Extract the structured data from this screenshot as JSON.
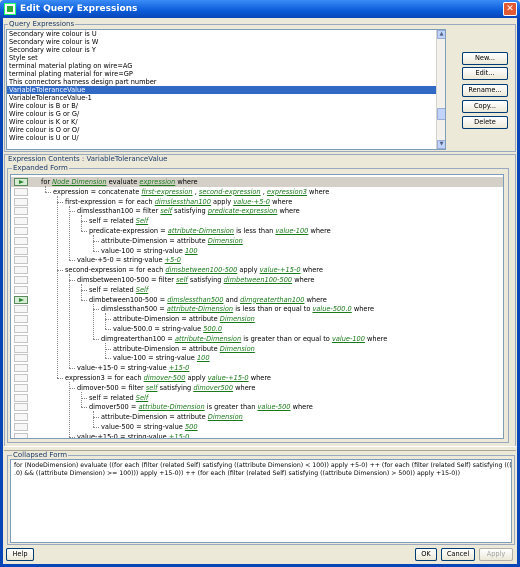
{
  "window": {
    "title": "Edit Query Expressions"
  },
  "query_expressions": {
    "label": "Query Expressions",
    "items": [
      "Secondary wire colour is U",
      "Secondary wire colour is W",
      "Secondary wire colour is Y",
      "Style set",
      "terminal material plating on wire=AG",
      "terminal plating material for wire=GP",
      "This connectors harness design  part number",
      "VariableToleranceValue",
      "VariableToleranceValue-1",
      "Wire colour is B or B/",
      "Wire colour is G or G/",
      "Wire colour is K or K/",
      "Wire colour is O or O/",
      "Wire colour is U or U/"
    ],
    "selected_index": 7
  },
  "buttons": {
    "new": "New...",
    "edit": "Edit...",
    "rename": "Rename...",
    "copy": "Copy...",
    "delete": "Delete",
    "help": "Help",
    "ok": "OK",
    "cancel": "Cancel",
    "apply": "Apply"
  },
  "expression_contents": {
    "label": "Expression Contents : VariableToleranceValue",
    "expanded_label": "Expanded Form",
    "collapsed_label": "Collapsed Form",
    "rows": [
      {
        "indent": 0,
        "marker": "on",
        "highlight": true,
        "parts": [
          [
            "t",
            "for "
          ],
          [
            "l",
            "Node Dimension"
          ],
          [
            "t",
            " evaluate "
          ],
          [
            "l",
            "expression"
          ],
          [
            "t",
            " where"
          ]
        ]
      },
      {
        "indent": 1,
        "parts": [
          [
            "t",
            "expression = concatenate "
          ],
          [
            "l",
            "first-expression"
          ],
          [
            "t",
            " , "
          ],
          [
            "l",
            "second-expression"
          ],
          [
            "t",
            " , "
          ],
          [
            "l",
            "expression3"
          ],
          [
            "t",
            " where"
          ]
        ]
      },
      {
        "indent": 2,
        "parts": [
          [
            "t",
            "first-expression = for each "
          ],
          [
            "l",
            "dimslessthan100"
          ],
          [
            "t",
            " apply "
          ],
          [
            "l",
            "value-+5-0"
          ],
          [
            "t",
            " where"
          ]
        ]
      },
      {
        "indent": 3,
        "parts": [
          [
            "t",
            "dimslessthan100 = filter "
          ],
          [
            "l",
            "self"
          ],
          [
            "t",
            " satisfying "
          ],
          [
            "l",
            "predicate-expression"
          ],
          [
            "t",
            " where"
          ]
        ]
      },
      {
        "indent": 4,
        "parts": [
          [
            "t",
            "self = related "
          ],
          [
            "l",
            "Self"
          ]
        ]
      },
      {
        "indent": 4,
        "parts": [
          [
            "t",
            "predicate-expression = "
          ],
          [
            "l",
            "attribute-Dimension"
          ],
          [
            "t",
            " is less than "
          ],
          [
            "l",
            "value-100"
          ],
          [
            "t",
            " where"
          ]
        ]
      },
      {
        "indent": 5,
        "parts": [
          [
            "t",
            "attribute-Dimension = attribute "
          ],
          [
            "l",
            "Dimension"
          ]
        ]
      },
      {
        "indent": 5,
        "parts": [
          [
            "t",
            "value-100 = string-value "
          ],
          [
            "l",
            "100"
          ]
        ]
      },
      {
        "indent": 3,
        "parts": [
          [
            "t",
            "value-+5-0 = string-value "
          ],
          [
            "l",
            "+5-0"
          ]
        ]
      },
      {
        "indent": 2,
        "parts": [
          [
            "t",
            "second-expression = for each "
          ],
          [
            "l",
            "dimsbetween100-500"
          ],
          [
            "t",
            " apply "
          ],
          [
            "l",
            "value-+15-0"
          ],
          [
            "t",
            " where"
          ]
        ]
      },
      {
        "indent": 3,
        "parts": [
          [
            "t",
            "dimsbetween100-500 = filter "
          ],
          [
            "l",
            "self"
          ],
          [
            "t",
            " satisfying "
          ],
          [
            "l",
            "dimbetween100-500"
          ],
          [
            "t",
            " where"
          ]
        ]
      },
      {
        "indent": 4,
        "parts": [
          [
            "t",
            "self = related "
          ],
          [
            "l",
            "Self"
          ]
        ]
      },
      {
        "indent": 4,
        "marker": "on",
        "parts": [
          [
            "t",
            "dimbetween100-500 = "
          ],
          [
            "l",
            "dimslessthan500"
          ],
          [
            "t",
            " and "
          ],
          [
            "l",
            "dimgreaterthan100"
          ],
          [
            "t",
            " where"
          ]
        ]
      },
      {
        "indent": 5,
        "parts": [
          [
            "t",
            "dimslessthan500 = "
          ],
          [
            "l",
            "attribute-Dimension"
          ],
          [
            "t",
            " is less than or equal to "
          ],
          [
            "l",
            "value-500.0"
          ],
          [
            "t",
            " where"
          ]
        ]
      },
      {
        "indent": 6,
        "parts": [
          [
            "t",
            "attribute-Dimension = attribute "
          ],
          [
            "l",
            "Dimension"
          ]
        ]
      },
      {
        "indent": 6,
        "parts": [
          [
            "t",
            "value-500.0 = string-value "
          ],
          [
            "l",
            "500.0"
          ]
        ]
      },
      {
        "indent": 5,
        "parts": [
          [
            "t",
            "dimgreaterthan100 = "
          ],
          [
            "l",
            "attribute-Dimension"
          ],
          [
            "t",
            " is greater than or equal to "
          ],
          [
            "l",
            "value-100"
          ],
          [
            "t",
            " where"
          ]
        ]
      },
      {
        "indent": 6,
        "parts": [
          [
            "t",
            "attribute-Dimension = attribute "
          ],
          [
            "l",
            "Dimension"
          ]
        ]
      },
      {
        "indent": 6,
        "parts": [
          [
            "t",
            "value-100 = string-value "
          ],
          [
            "l",
            "100"
          ]
        ]
      },
      {
        "indent": 3,
        "parts": [
          [
            "t",
            "value-+15-0 = string-value "
          ],
          [
            "l",
            "+15-0"
          ]
        ]
      },
      {
        "indent": 2,
        "parts": [
          [
            "t",
            "expression3 = for each "
          ],
          [
            "l",
            "dimover-500"
          ],
          [
            "t",
            " apply "
          ],
          [
            "l",
            "value-+15-0"
          ],
          [
            "t",
            " where"
          ]
        ]
      },
      {
        "indent": 3,
        "parts": [
          [
            "t",
            "dimover-500 = filter "
          ],
          [
            "l",
            "self"
          ],
          [
            "t",
            " satisfying "
          ],
          [
            "l",
            "dimover500"
          ],
          [
            "t",
            " where"
          ]
        ]
      },
      {
        "indent": 4,
        "parts": [
          [
            "t",
            "self = related "
          ],
          [
            "l",
            "Self"
          ]
        ]
      },
      {
        "indent": 4,
        "parts": [
          [
            "t",
            "dimover500 = "
          ],
          [
            "l",
            "attribute-Dimension"
          ],
          [
            "t",
            " is greater than "
          ],
          [
            "l",
            "value-500"
          ],
          [
            "t",
            " where"
          ]
        ]
      },
      {
        "indent": 5,
        "parts": [
          [
            "t",
            "attribute-Dimension = attribute "
          ],
          [
            "l",
            "Dimension"
          ]
        ]
      },
      {
        "indent": 5,
        "parts": [
          [
            "t",
            "value-500 = string-value "
          ],
          [
            "l",
            "500"
          ]
        ]
      },
      {
        "indent": 3,
        "parts": [
          [
            "t",
            "value-+15-0 = string-value "
          ],
          [
            "l",
            "+15-0"
          ]
        ]
      }
    ],
    "collapsed_lines": [
      "for (NodeDimension) evaluate ((for each (filter (related Self) satisfying ((attribute Dimension) < 100)) apply +5-0) ++  (for each (filter (related Self) satisfying (((attribute Dimension) <= 500",
      ".0) && ((attribute Dimension) >= 100))) apply +15-0)) ++  (for each (filter (related Self) satisfying ((attribute Dimension) > 500)) apply +15-0))"
    ]
  }
}
